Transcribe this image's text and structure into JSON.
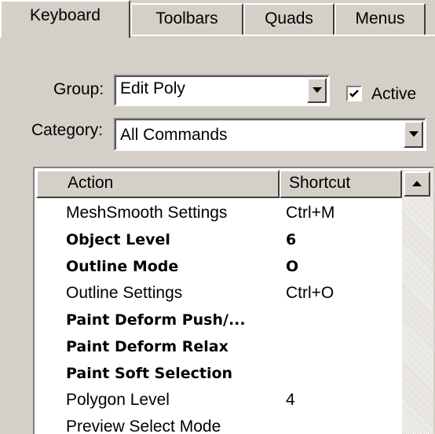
{
  "tabs": [
    {
      "label": "Keyboard",
      "active": true
    },
    {
      "label": "Toolbars",
      "active": false
    },
    {
      "label": "Quads",
      "active": false
    },
    {
      "label": "Menus",
      "active": false
    }
  ],
  "group": {
    "label": "Group:",
    "value": "Edit Poly"
  },
  "active": {
    "label": "Active",
    "checked": true
  },
  "category": {
    "label": "Category:",
    "value": "All Commands"
  },
  "list": {
    "headers": {
      "action": "Action",
      "shortcut": "Shortcut"
    },
    "rows": [
      {
        "action": "MeshSmooth Settings",
        "shortcut": "Ctrl+M",
        "bold": false
      },
      {
        "action": "Object Level",
        "shortcut": "6",
        "bold": true
      },
      {
        "action": "Outline Mode",
        "shortcut": "O",
        "bold": true
      },
      {
        "action": "Outline Settings",
        "shortcut": "Ctrl+O",
        "bold": false
      },
      {
        "action": "Paint Deform Push/...",
        "shortcut": "",
        "bold": true
      },
      {
        "action": "Paint Deform Relax",
        "shortcut": "",
        "bold": true
      },
      {
        "action": "Paint Soft Selection",
        "shortcut": "",
        "bold": true
      },
      {
        "action": "Polygon Level",
        "shortcut": "4",
        "bold": false
      },
      {
        "action": "Preview Select Mode",
        "shortcut": "",
        "bold": false
      }
    ]
  }
}
